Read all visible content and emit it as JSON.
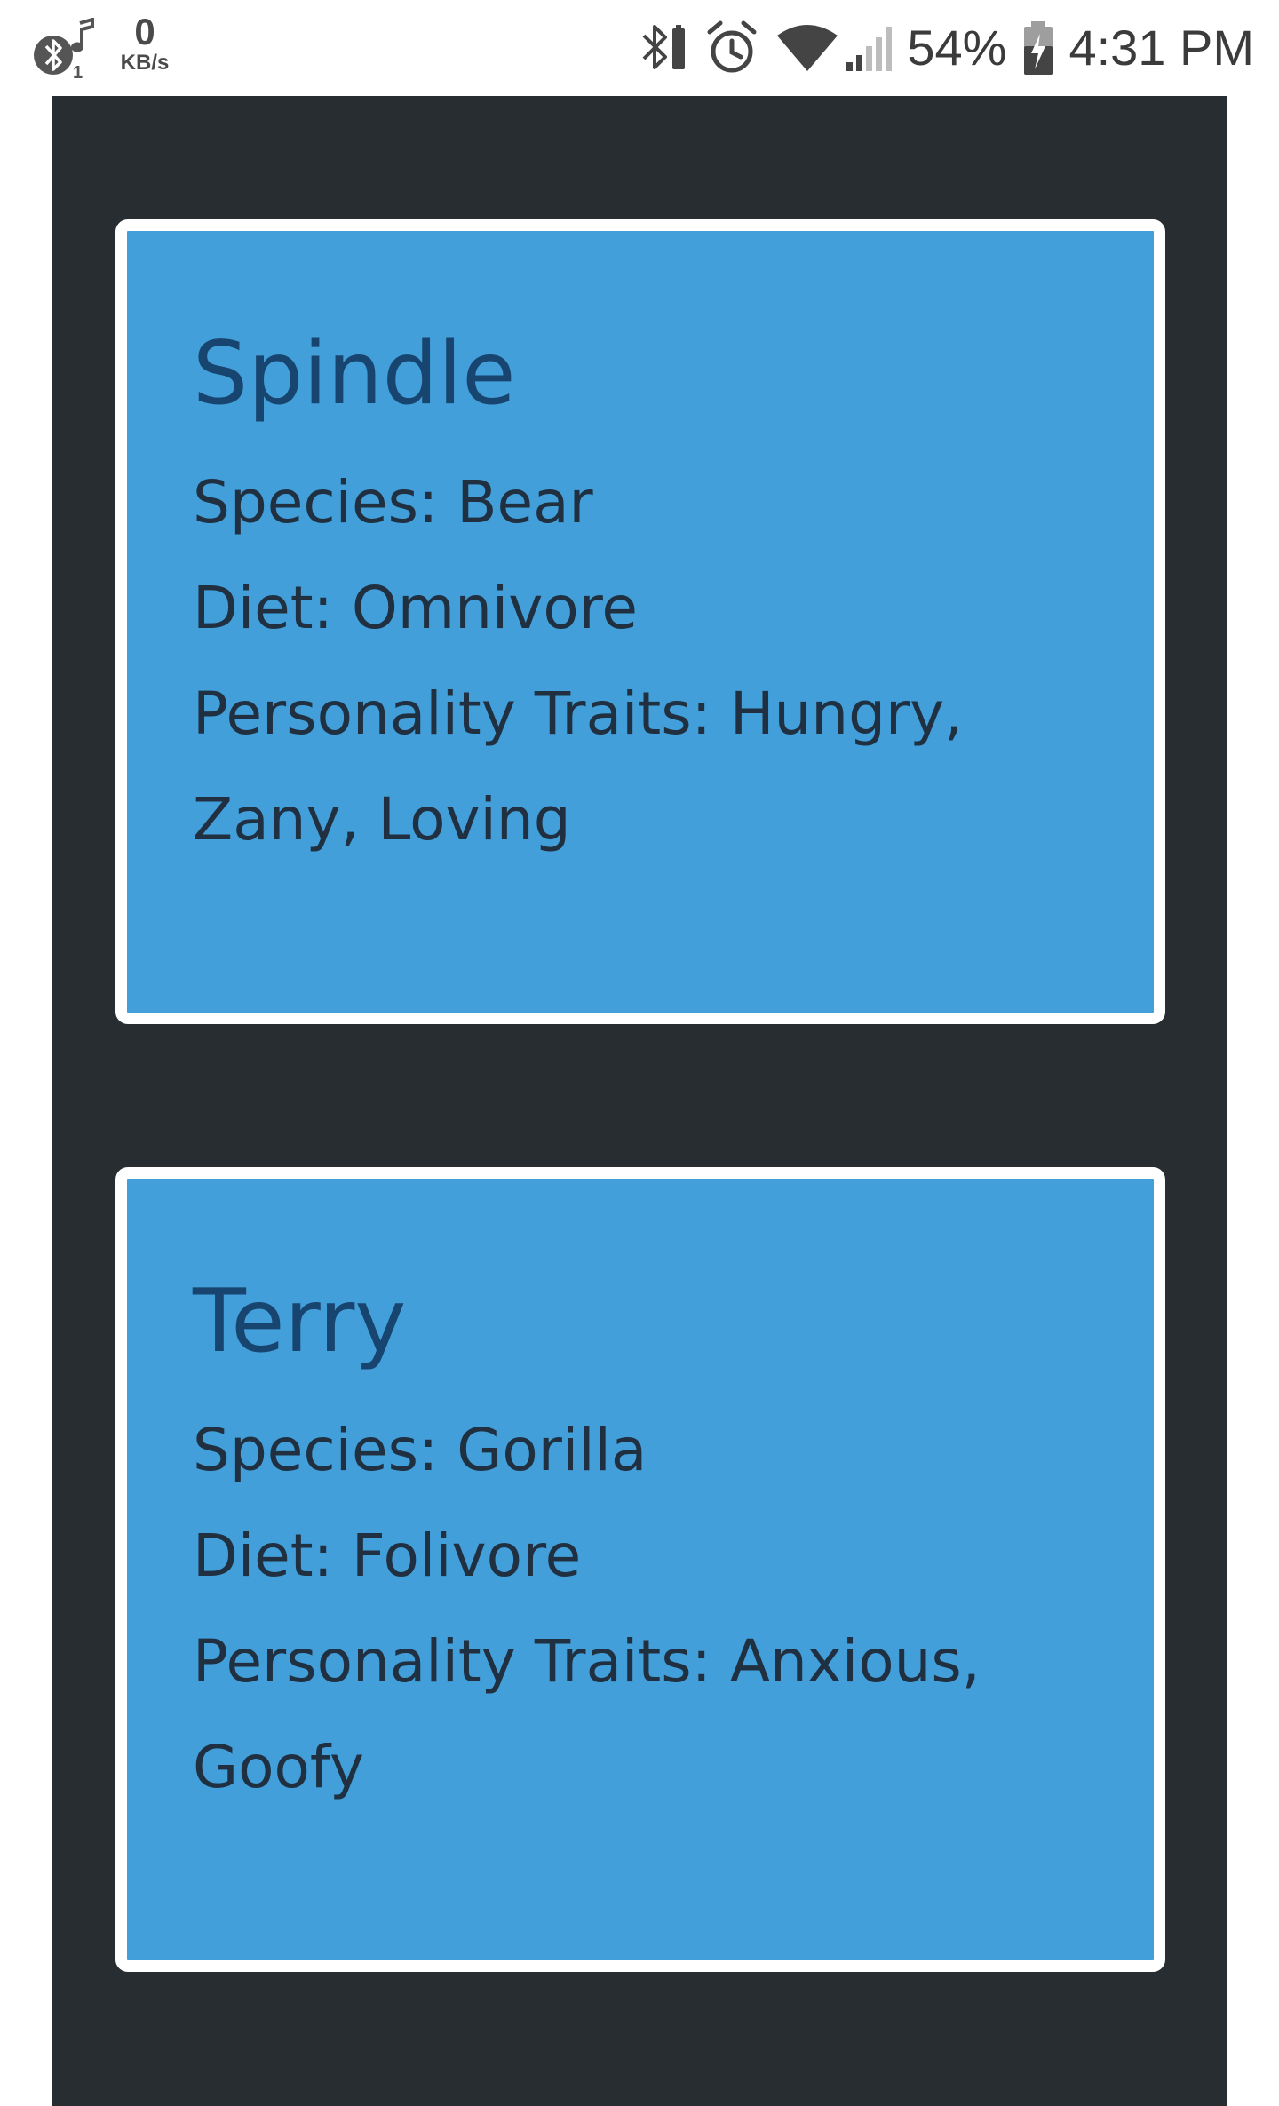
{
  "status_bar": {
    "net_speed_value": "0",
    "net_speed_unit": "KB/s",
    "battery_percent": "54%",
    "time": "4:31 PM",
    "icons": [
      "bluetooth-icon",
      "music-note-icon",
      "bluetooth-battery-icon",
      "alarm-icon",
      "wifi-icon",
      "cellular-signal-icon",
      "battery-charging-icon"
    ]
  },
  "colors": {
    "background": "#272d31",
    "card_fill": "#429fd9",
    "card_border": "#ffffff",
    "title_text": "#17456f",
    "body_text": "#203040"
  },
  "cards": [
    {
      "name": "Spindle",
      "species_line": "Species: Bear",
      "diet_line": "Diet: Omnivore",
      "traits_line1": "Personality Traits: Hungry,",
      "traits_line2": "Zany, Loving"
    },
    {
      "name": "Terry",
      "species_line": "Species: Gorilla",
      "diet_line": "Diet: Folivore",
      "traits_line1": "Personality Traits: Anxious,",
      "traits_line2": "Goofy"
    }
  ]
}
